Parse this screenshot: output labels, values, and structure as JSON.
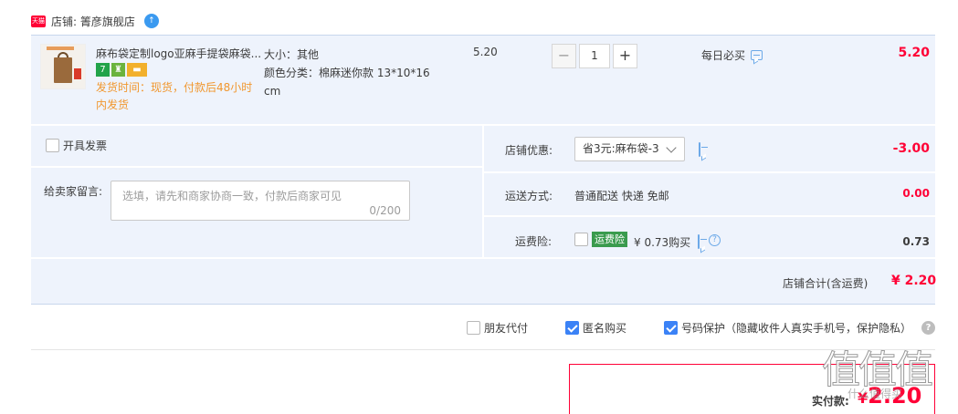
{
  "shop": {
    "badge_text": "天猫",
    "name": "店铺: 箐彦旗舰店",
    "ww_icon_text": "↑"
  },
  "item": {
    "title": "麻布袋定制logo亚麻手提袋麻袋...",
    "service_icons": [
      "seven-day-icon",
      "guarantee-icon",
      "card-icon"
    ],
    "service_icon_glyphs": [
      "7",
      "♜",
      "▬"
    ],
    "ship_time": "发货时间：现货，付款后48小时内发货",
    "spec_size": "大小：其他",
    "spec_color": "颜色分类：棉麻迷你款 13*10*16 cm",
    "unit_price": "5.20",
    "qty_minus": "−",
    "qty_value": "1",
    "qty_plus": "+",
    "promo": "每日必买",
    "subtotal": "5.20"
  },
  "options": {
    "invoice_label": "开具发票",
    "message_label": "给卖家留言:",
    "message_placeholder": "选填，请先和商家协商一致，付款后商家可见",
    "message_count": "0/200",
    "shop_discount_label": "店铺优惠:",
    "shop_discount_value": "省3元:麻布袋-3",
    "shop_discount_amount": "-3.00",
    "shipping_label": "运送方式:",
    "shipping_value": "普通配送 快递 免邮",
    "shipping_amount": "0.00",
    "insurance_label": "运费险:",
    "insurance_badge": "运费险",
    "insurance_text": "¥ 0.73购买",
    "insurance_help": "?",
    "insurance_amount": "0.73",
    "sum_label": "店铺合计(含运费)",
    "sum_amount": "¥ 2.20"
  },
  "bottom": {
    "friend_pay": "朋友代付",
    "anonymous": "匿名购买",
    "number_protect": "号码保护（隐藏收件人真实手机号，保护隐私）",
    "help": "?"
  },
  "pay": {
    "label": "实付款:",
    "currency": "¥",
    "amount": "2.20"
  },
  "watermark": {
    "text": "值值值",
    "sub": "什么值得买"
  },
  "colors": {
    "accent_red": "#ff0036",
    "row_bg": "#eef3fc",
    "ship_time_orange": "#f1972f",
    "check_blue": "#3b82f6",
    "insurance_green": "#3a9b4d"
  }
}
